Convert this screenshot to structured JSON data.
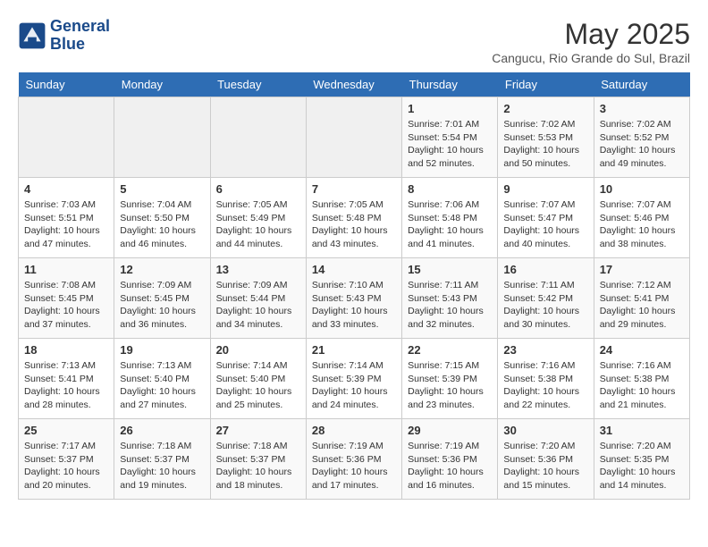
{
  "logo": {
    "line1": "General",
    "line2": "Blue"
  },
  "title": "May 2025",
  "location": "Cangucu, Rio Grande do Sul, Brazil",
  "days_of_week": [
    "Sunday",
    "Monday",
    "Tuesday",
    "Wednesday",
    "Thursday",
    "Friday",
    "Saturday"
  ],
  "weeks": [
    [
      {
        "day": "",
        "info": ""
      },
      {
        "day": "",
        "info": ""
      },
      {
        "day": "",
        "info": ""
      },
      {
        "day": "",
        "info": ""
      },
      {
        "day": "1",
        "info": "Sunrise: 7:01 AM\nSunset: 5:54 PM\nDaylight: 10 hours\nand 52 minutes."
      },
      {
        "day": "2",
        "info": "Sunrise: 7:02 AM\nSunset: 5:53 PM\nDaylight: 10 hours\nand 50 minutes."
      },
      {
        "day": "3",
        "info": "Sunrise: 7:02 AM\nSunset: 5:52 PM\nDaylight: 10 hours\nand 49 minutes."
      }
    ],
    [
      {
        "day": "4",
        "info": "Sunrise: 7:03 AM\nSunset: 5:51 PM\nDaylight: 10 hours\nand 47 minutes."
      },
      {
        "day": "5",
        "info": "Sunrise: 7:04 AM\nSunset: 5:50 PM\nDaylight: 10 hours\nand 46 minutes."
      },
      {
        "day": "6",
        "info": "Sunrise: 7:05 AM\nSunset: 5:49 PM\nDaylight: 10 hours\nand 44 minutes."
      },
      {
        "day": "7",
        "info": "Sunrise: 7:05 AM\nSunset: 5:48 PM\nDaylight: 10 hours\nand 43 minutes."
      },
      {
        "day": "8",
        "info": "Sunrise: 7:06 AM\nSunset: 5:48 PM\nDaylight: 10 hours\nand 41 minutes."
      },
      {
        "day": "9",
        "info": "Sunrise: 7:07 AM\nSunset: 5:47 PM\nDaylight: 10 hours\nand 40 minutes."
      },
      {
        "day": "10",
        "info": "Sunrise: 7:07 AM\nSunset: 5:46 PM\nDaylight: 10 hours\nand 38 minutes."
      }
    ],
    [
      {
        "day": "11",
        "info": "Sunrise: 7:08 AM\nSunset: 5:45 PM\nDaylight: 10 hours\nand 37 minutes."
      },
      {
        "day": "12",
        "info": "Sunrise: 7:09 AM\nSunset: 5:45 PM\nDaylight: 10 hours\nand 36 minutes."
      },
      {
        "day": "13",
        "info": "Sunrise: 7:09 AM\nSunset: 5:44 PM\nDaylight: 10 hours\nand 34 minutes."
      },
      {
        "day": "14",
        "info": "Sunrise: 7:10 AM\nSunset: 5:43 PM\nDaylight: 10 hours\nand 33 minutes."
      },
      {
        "day": "15",
        "info": "Sunrise: 7:11 AM\nSunset: 5:43 PM\nDaylight: 10 hours\nand 32 minutes."
      },
      {
        "day": "16",
        "info": "Sunrise: 7:11 AM\nSunset: 5:42 PM\nDaylight: 10 hours\nand 30 minutes."
      },
      {
        "day": "17",
        "info": "Sunrise: 7:12 AM\nSunset: 5:41 PM\nDaylight: 10 hours\nand 29 minutes."
      }
    ],
    [
      {
        "day": "18",
        "info": "Sunrise: 7:13 AM\nSunset: 5:41 PM\nDaylight: 10 hours\nand 28 minutes."
      },
      {
        "day": "19",
        "info": "Sunrise: 7:13 AM\nSunset: 5:40 PM\nDaylight: 10 hours\nand 27 minutes."
      },
      {
        "day": "20",
        "info": "Sunrise: 7:14 AM\nSunset: 5:40 PM\nDaylight: 10 hours\nand 25 minutes."
      },
      {
        "day": "21",
        "info": "Sunrise: 7:14 AM\nSunset: 5:39 PM\nDaylight: 10 hours\nand 24 minutes."
      },
      {
        "day": "22",
        "info": "Sunrise: 7:15 AM\nSunset: 5:39 PM\nDaylight: 10 hours\nand 23 minutes."
      },
      {
        "day": "23",
        "info": "Sunrise: 7:16 AM\nSunset: 5:38 PM\nDaylight: 10 hours\nand 22 minutes."
      },
      {
        "day": "24",
        "info": "Sunrise: 7:16 AM\nSunset: 5:38 PM\nDaylight: 10 hours\nand 21 minutes."
      }
    ],
    [
      {
        "day": "25",
        "info": "Sunrise: 7:17 AM\nSunset: 5:37 PM\nDaylight: 10 hours\nand 20 minutes."
      },
      {
        "day": "26",
        "info": "Sunrise: 7:18 AM\nSunset: 5:37 PM\nDaylight: 10 hours\nand 19 minutes."
      },
      {
        "day": "27",
        "info": "Sunrise: 7:18 AM\nSunset: 5:37 PM\nDaylight: 10 hours\nand 18 minutes."
      },
      {
        "day": "28",
        "info": "Sunrise: 7:19 AM\nSunset: 5:36 PM\nDaylight: 10 hours\nand 17 minutes."
      },
      {
        "day": "29",
        "info": "Sunrise: 7:19 AM\nSunset: 5:36 PM\nDaylight: 10 hours\nand 16 minutes."
      },
      {
        "day": "30",
        "info": "Sunrise: 7:20 AM\nSunset: 5:36 PM\nDaylight: 10 hours\nand 15 minutes."
      },
      {
        "day": "31",
        "info": "Sunrise: 7:20 AM\nSunset: 5:35 PM\nDaylight: 10 hours\nand 14 minutes."
      }
    ]
  ]
}
